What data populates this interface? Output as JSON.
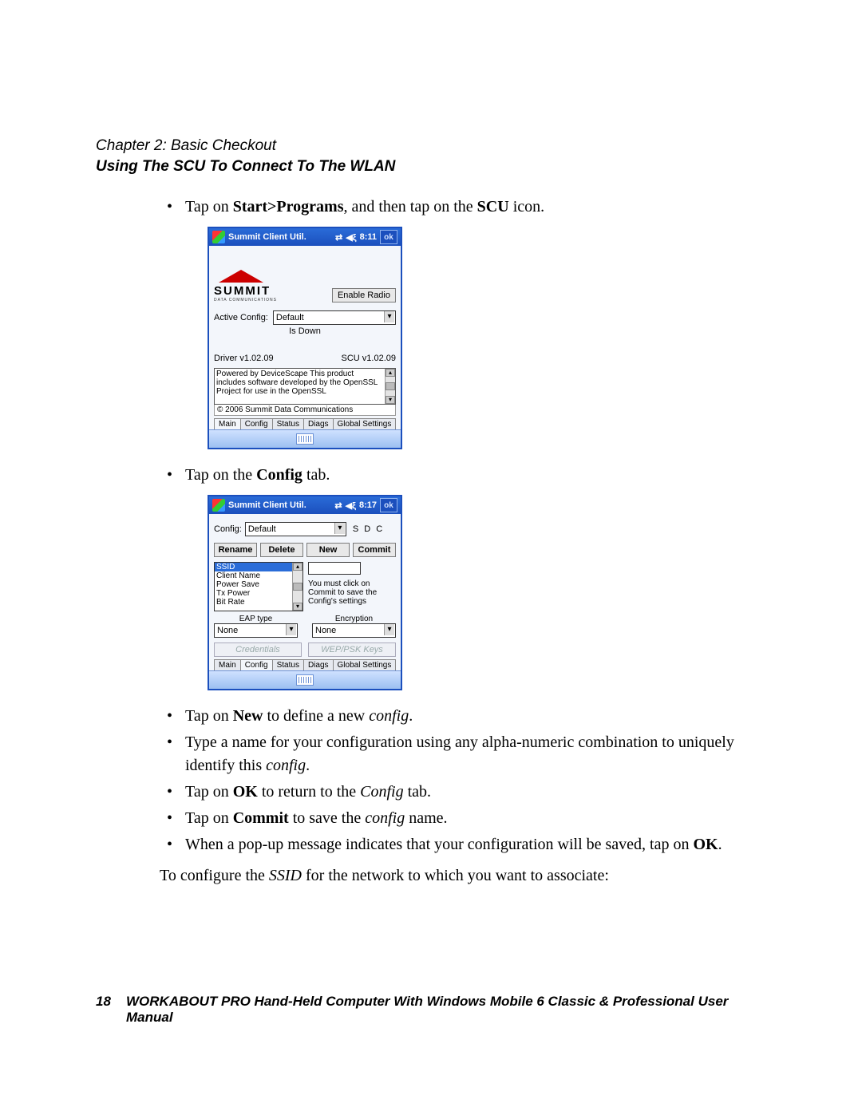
{
  "header": {
    "chapter": "Chapter  2:  Basic Checkout",
    "section": "Using The SCU To Connect To The WLAN"
  },
  "step1_html": "Tap on <b>Start&gt;Programs</b>, and then tap on the <b>SCU</b> icon.",
  "step2_html": "Tap on the <b>Config</b> tab.",
  "steps_lower": [
    "Tap on <b>New</b> to define a new <i>config</i>.",
    "Type a name for your configuration using any alpha-numeric combination to uniquely identify this <i>config</i>.",
    "Tap on <b>OK</b> to return to the <i>Config</i> tab.",
    "Tap on <b>Commit</b> to save the <i>config</i> name.",
    "When a pop-up message indicates that your configuration will be saved, tap on <b>OK</b>."
  ],
  "closing_html": "To configure the <i>SSID</i> for the network to which you want to associate:",
  "shot_main": {
    "title": "Summit Client Util.",
    "time": "8:11",
    "ok": "ok",
    "brand_word": "SUMMIT",
    "brand_sub": "DATA COMMUNICATIONS",
    "enable_radio": "Enable Radio",
    "active_config_label": "Active Config:",
    "active_config_value": "Default",
    "status": "Is Down",
    "driver": "Driver v1.02.09",
    "scu": "SCU v1.02.09",
    "about_text": "Powered by DeviceScape\nThis product includes software\ndeveloped by the OpenSSL\nProject for use in the OpenSSL",
    "copyright": "© 2006 Summit Data Communications",
    "tabs": [
      "Main",
      "Config",
      "Status",
      "Diags",
      "Global Settings"
    ],
    "active_tab": 0
  },
  "shot_config": {
    "title": "Summit Client Util.",
    "time": "8:17",
    "ok": "ok",
    "config_label": "Config:",
    "config_value": "Default",
    "sdc": "S D C",
    "buttons": [
      "Rename",
      "Delete",
      "New",
      "Commit"
    ],
    "list_items": [
      "SSID",
      "Client Name",
      "Power Save",
      "Tx Power",
      "Bit Rate"
    ],
    "help_text": "You must click on Commit to save the Config's settings",
    "eap_label": "EAP type",
    "eap_value": "None",
    "enc_label": "Encryption",
    "enc_value": "None",
    "disabled_buttons": [
      "Credentials",
      "WEP/PSK Keys"
    ],
    "tabs": [
      "Main",
      "Config",
      "Status",
      "Diags",
      "Global Settings"
    ],
    "active_tab": 1
  },
  "footer": {
    "page": "18",
    "text": "WORKABOUT PRO Hand-Held Computer With Windows Mobile 6 Classic & Professional User Manual"
  }
}
